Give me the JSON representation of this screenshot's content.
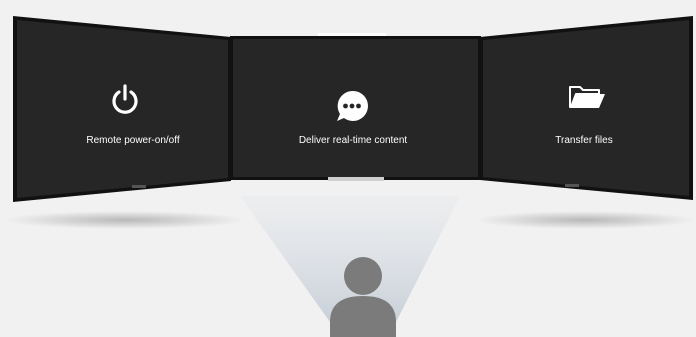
{
  "screens": [
    {
      "label": "Remote power-on/off",
      "icon": "power-icon"
    },
    {
      "label": "Deliver real-time content",
      "icon": "chat-bubble-icon"
    },
    {
      "label": "Transfer files",
      "icon": "folder-open-icon"
    }
  ],
  "colors": {
    "background": "#f1f1f1",
    "screen": "#262626",
    "bezel": "#111111",
    "person": "#7b7b7b",
    "text": "#ffffff"
  }
}
